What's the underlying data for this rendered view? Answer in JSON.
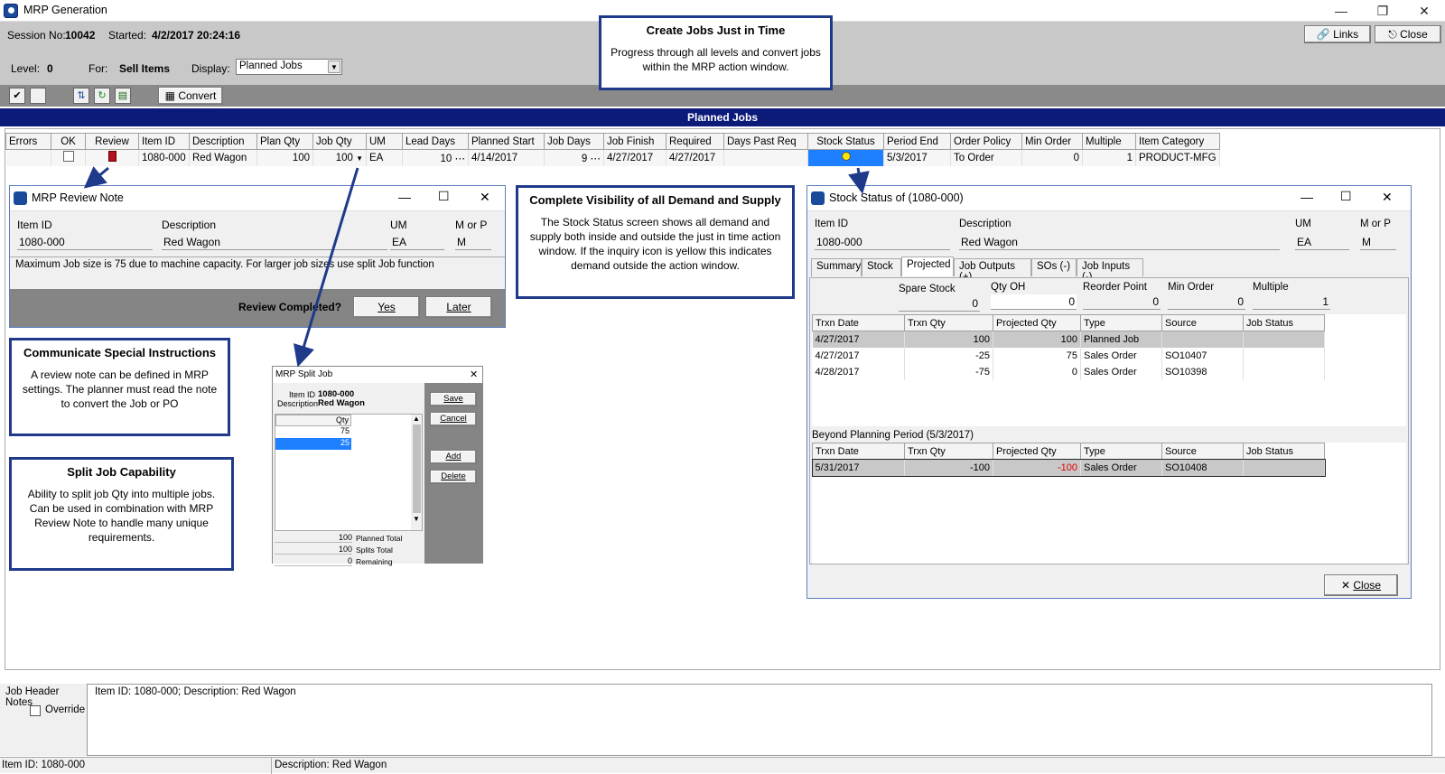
{
  "window": {
    "title": "MRP Generation"
  },
  "header": {
    "session_label": "Session No:",
    "session_value": "10042",
    "started_label": "Started:",
    "started_value": "4/2/2017 20:24:16",
    "level_label": "Level:",
    "level_value": "0",
    "for_label": "For:",
    "for_value": "Sell Items",
    "display_label": "Display:",
    "display_value": "Planned Jobs",
    "links_label": "Links",
    "close_label": "Close"
  },
  "toolbar": {
    "convert_label": "Convert"
  },
  "section_title": "Planned Jobs",
  "grid": {
    "columns": [
      "Errors",
      "OK",
      "Review",
      "Item ID",
      "Description",
      "Plan Qty",
      "Job Qty",
      "UM",
      "Lead Days",
      "Planned Start",
      "Job Days",
      "Job Finish",
      "Required",
      "Days Past Req",
      "Stock Status",
      "Period End",
      "Order Policy",
      "Min Order",
      "Multiple",
      "Item Category"
    ],
    "row": {
      "item_id": "1080-000",
      "description": "Red Wagon",
      "plan_qty": "100",
      "job_qty": "100",
      "um": "EA",
      "lead_days": "10",
      "planned_start": "4/14/2017",
      "job_days": "9",
      "job_finish": "4/27/2017",
      "required": "4/27/2017",
      "period_end": "5/3/2017",
      "order_policy": "To Order",
      "min_order": "0",
      "multiple": "1",
      "item_category": "PRODUCT-MFG"
    }
  },
  "callouts": {
    "jit": {
      "title": "Create Jobs Just in Time",
      "body": "Progress through all levels and convert jobs within the MRP action window."
    },
    "visibility": {
      "title": "Complete Visibility of all Demand and Supply",
      "body": "The Stock Status screen shows all demand and supply both inside and outside the just in time action window.  If the inquiry icon is yellow this indicates demand outside the action window."
    },
    "special": {
      "title": "Communicate Special Instructions",
      "body": "A review note can be defined in MRP settings.  The planner must read the note to convert the Job or PO"
    },
    "split": {
      "title": "Split Job Capability",
      "body": "Ability to split job Qty into multiple jobs. Can be used in combination with MRP Review Note to handle many unique requirements."
    }
  },
  "review_note": {
    "title": "MRP Review Note",
    "item_id_label": "Item ID",
    "item_id": "1080-000",
    "desc_label": "Description",
    "desc": "Red Wagon",
    "um_label": "UM",
    "um": "EA",
    "morp_label": "M or P",
    "morp": "M",
    "note": "Maximum Job size is 75 due to machine capacity.   For larger job sizes use split Job function",
    "question": "Review Completed?",
    "yes": "Yes",
    "later": "Later"
  },
  "split_job": {
    "title": "MRP Split Job",
    "item_id_label": "Item ID",
    "item_id": "1080-000",
    "desc_label": "Description",
    "desc": "Red Wagon",
    "qty_header": "Qty",
    "rows": [
      "75",
      "25"
    ],
    "save": "Save",
    "cancel": "Cancel",
    "add": "Add",
    "delete": "Delete",
    "planned_total": "100",
    "planned_total_label": "Planned Total",
    "splits_total": "100",
    "splits_total_label": "Splits Total",
    "remaining": "0",
    "remaining_label": "Remaining"
  },
  "stock_status": {
    "title": "Stock Status of (1080-000)",
    "item_id_label": "Item ID",
    "item_id": "1080-000",
    "desc_label": "Description",
    "desc": "Red Wagon",
    "um_label": "UM",
    "um": "EA",
    "morp_label": "M or P",
    "morp": "M",
    "tabs": [
      "Summary",
      "Stock",
      "Projected",
      "Job Outputs (+)",
      "SOs (-)",
      "Job Inputs (-)"
    ],
    "spare_stock_label": "Spare Stock",
    "spare_stock": "0",
    "qty_oh_label": "Qty OH",
    "qty_oh": "0",
    "reorder_label": "Reorder Point",
    "reorder": "0",
    "min_order_label": "Min Order",
    "min_order": "0",
    "multiple_label": "Multiple",
    "multiple": "1",
    "columns": [
      "Trxn Date",
      "Trxn Qty",
      "Projected Qty",
      "Type",
      "Source",
      "Job Status"
    ],
    "rows": [
      [
        "4/27/2017",
        "100",
        "100",
        "Planned Job",
        "",
        ""
      ],
      [
        "4/27/2017",
        "-25",
        "75",
        "Sales Order",
        "SO10407",
        ""
      ],
      [
        "4/28/2017",
        "-75",
        "0",
        "Sales Order",
        "SO10398",
        ""
      ]
    ],
    "beyond_label": "Beyond Planning Period (5/3/2017)",
    "beyond_rows": [
      [
        "5/31/2017",
        "-100",
        "-100",
        "Sales Order",
        "SO10408",
        ""
      ]
    ],
    "close": "Close"
  },
  "notes": {
    "label": "Job Header Notes",
    "override": "Override",
    "text": "Item ID: 1080-000; Description: Red Wagon"
  },
  "statusbar": {
    "left": "Item ID: 1080-000",
    "right": "Description: Red Wagon"
  }
}
